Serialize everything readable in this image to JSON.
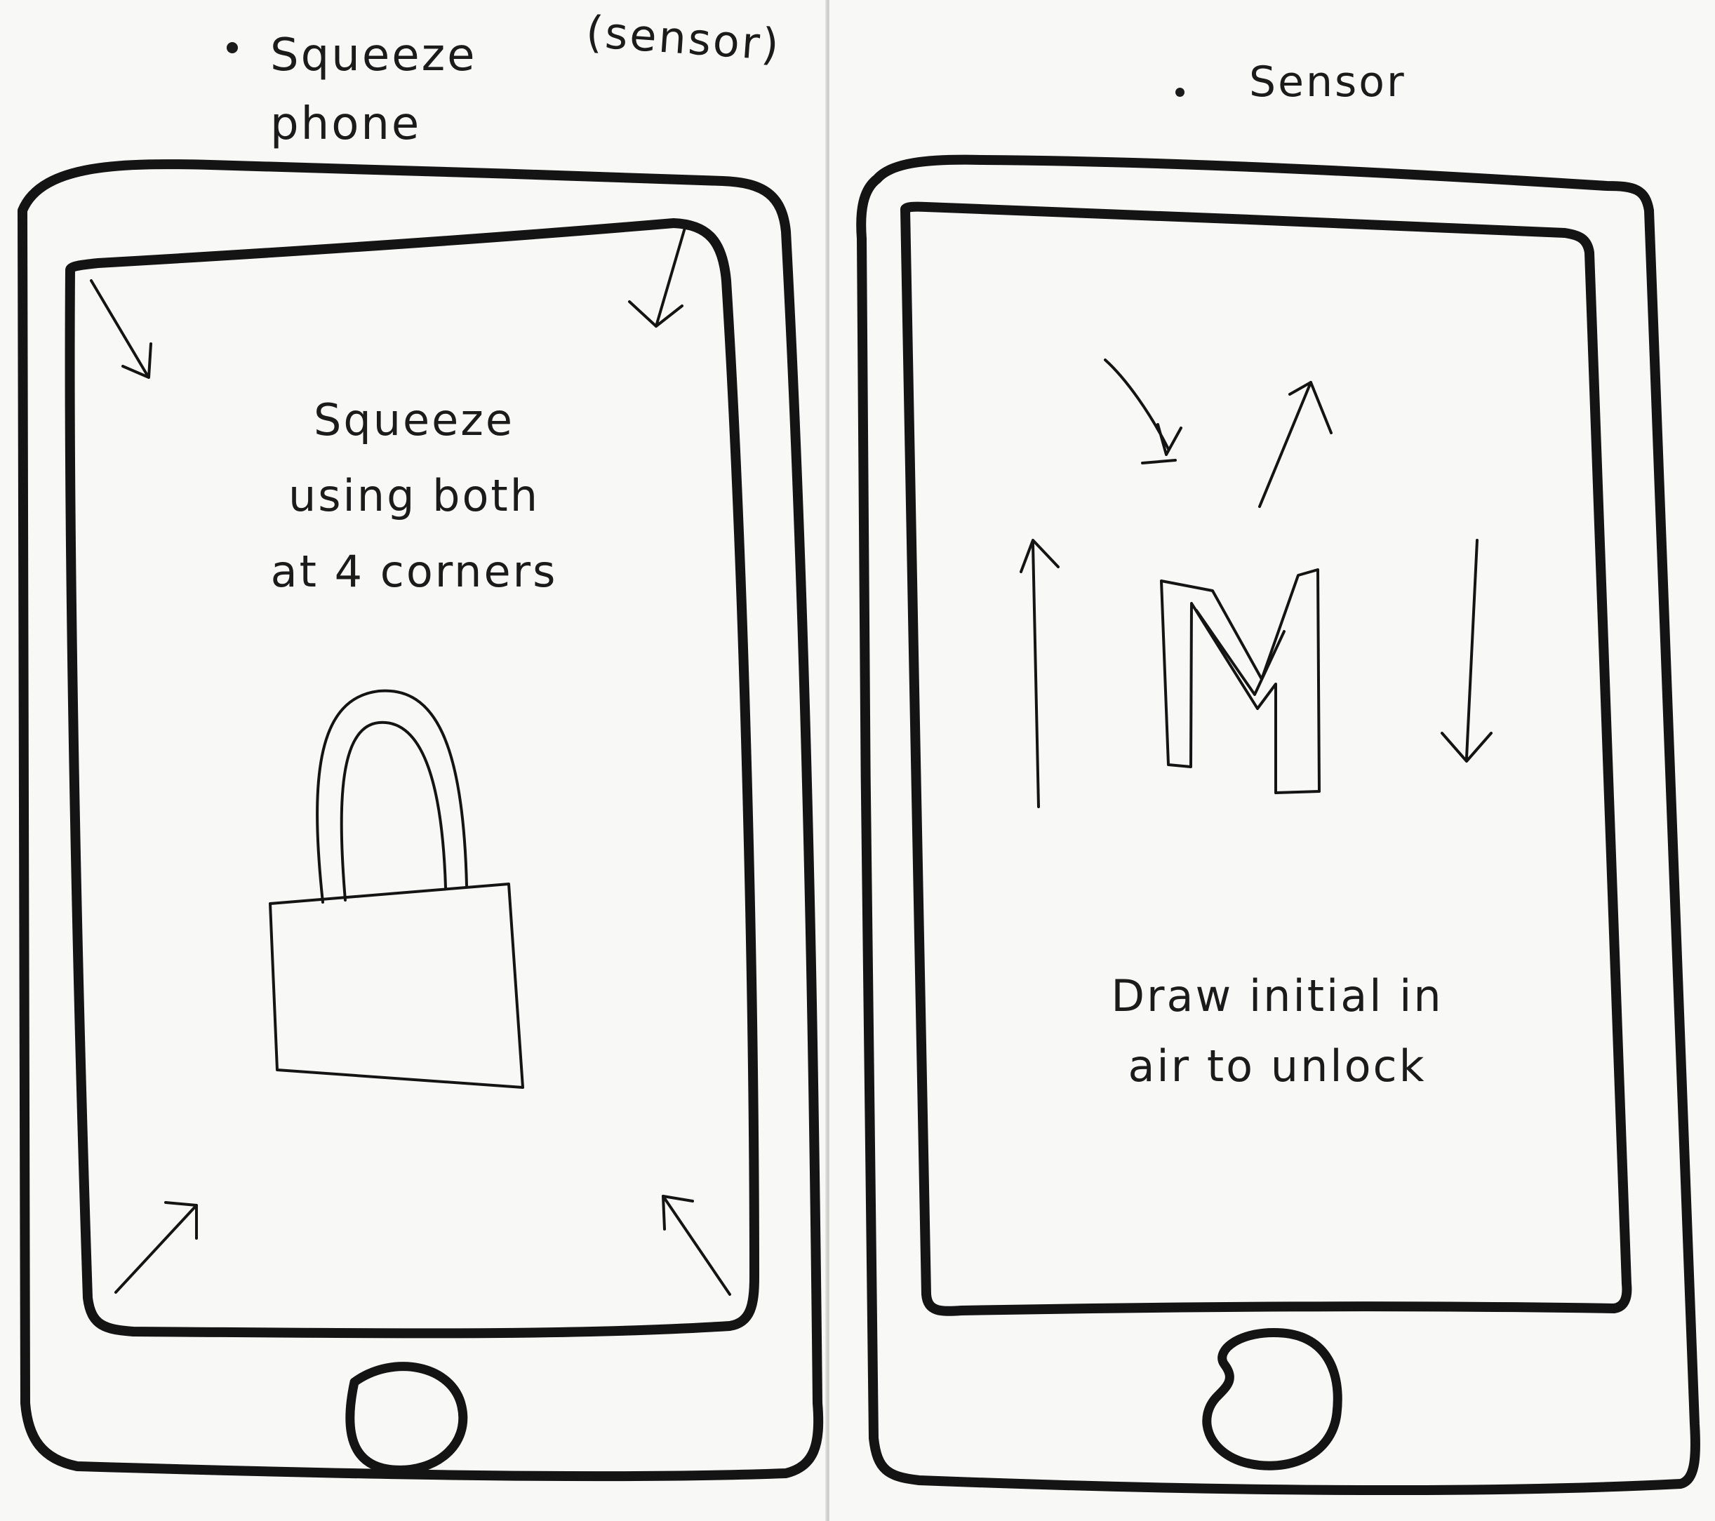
{
  "left_sketch": {
    "note_line1": "Squeeze",
    "note_line2": "phone",
    "note_tag": "(sensor)",
    "screen_text": [
      "Squeeze",
      "using both",
      "at 4 corners"
    ]
  },
  "right_sketch": {
    "note": "Sensor",
    "letter": "M",
    "screen_text": [
      "Draw initial in",
      "air to unlock"
    ]
  },
  "colors": {
    "ink": "#141414",
    "paper": "#f8f8f6"
  }
}
